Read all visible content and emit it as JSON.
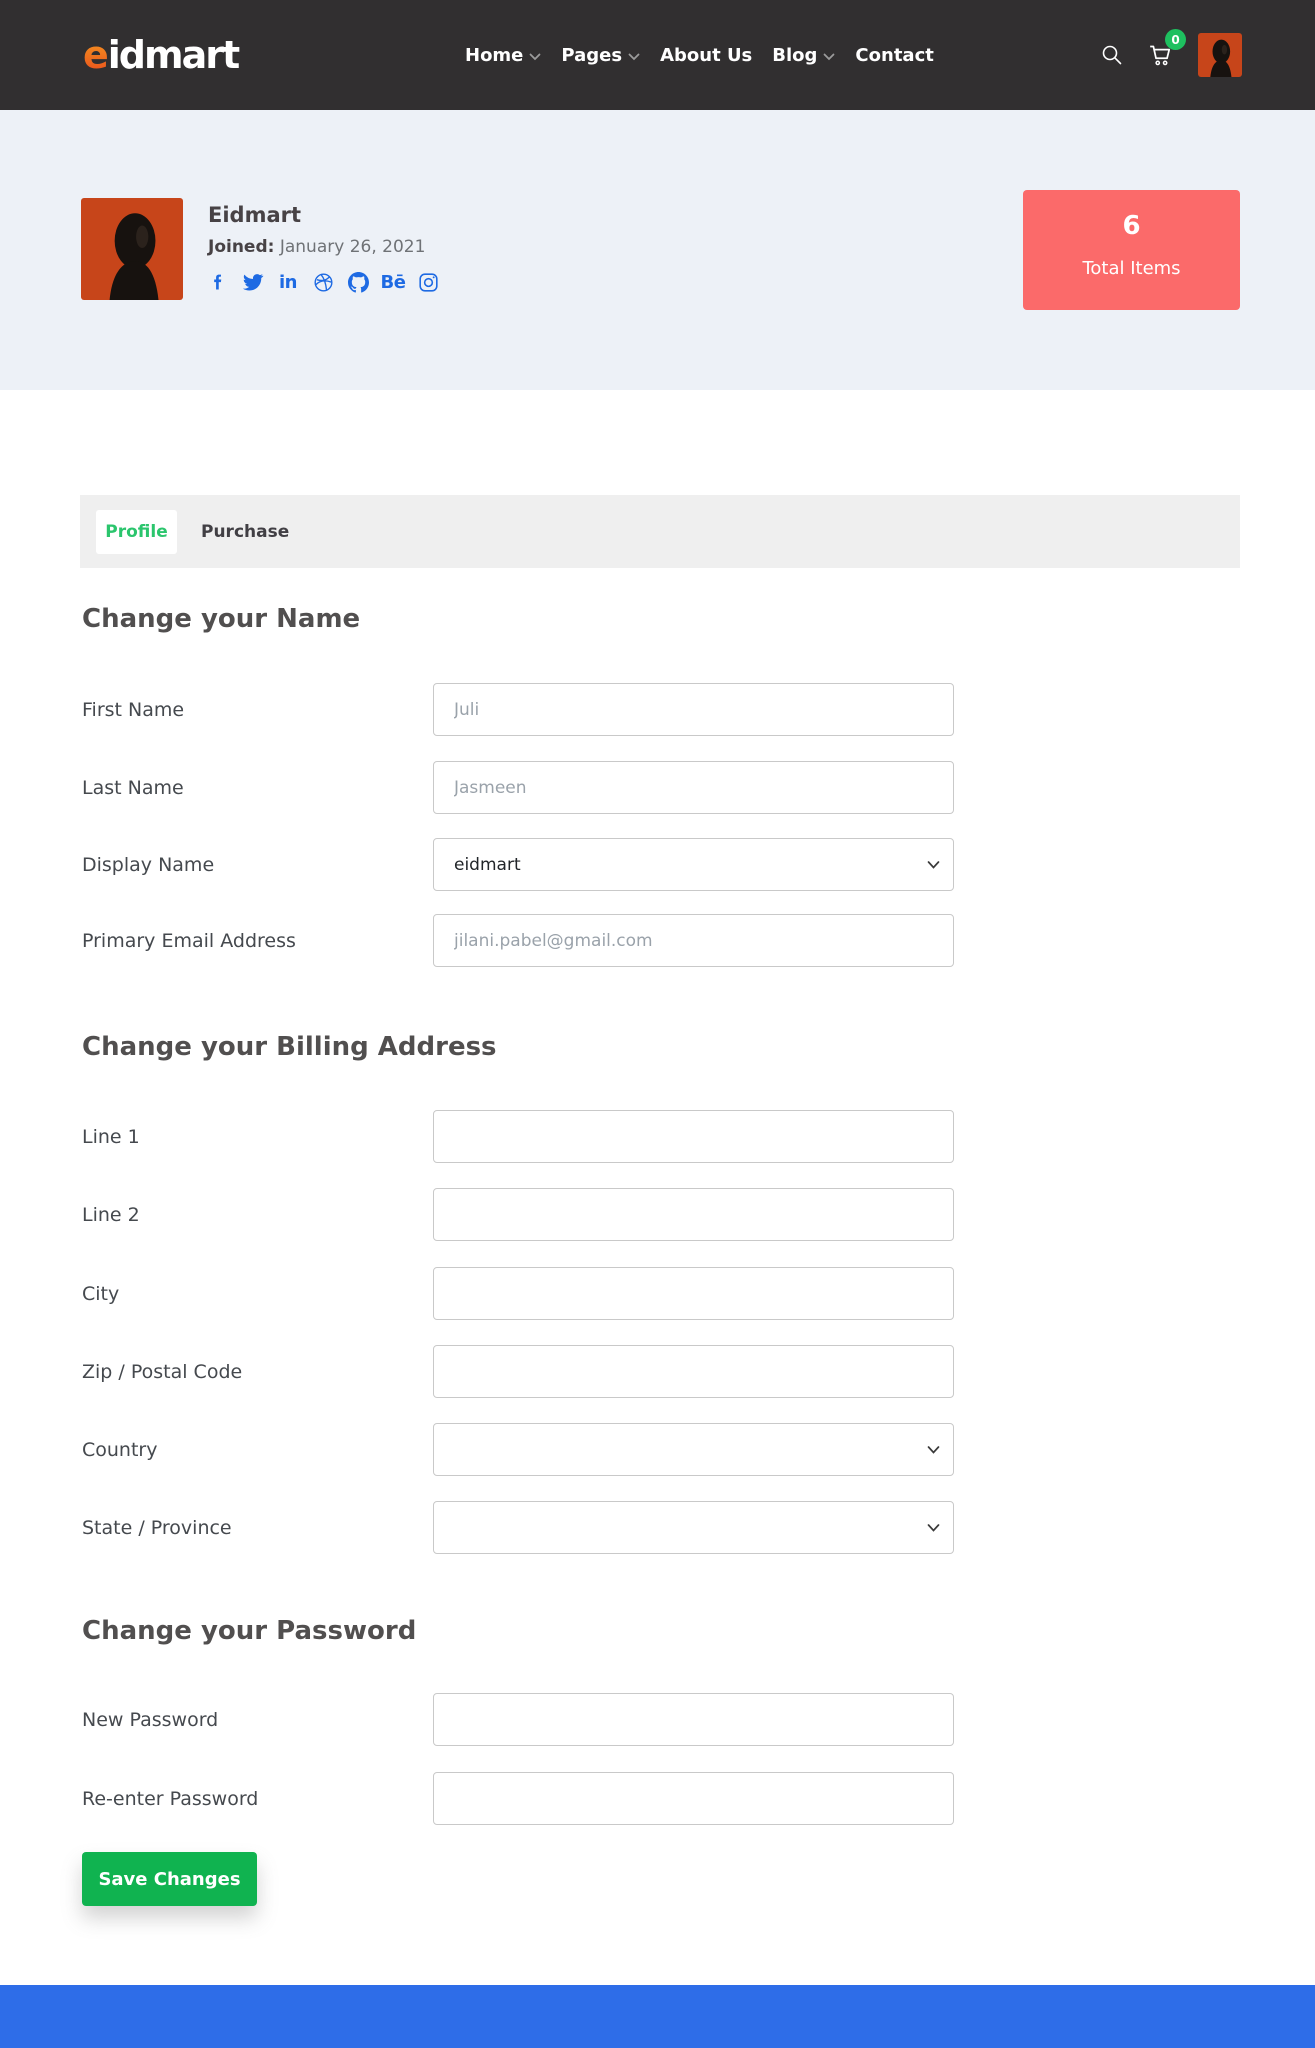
{
  "navbar": {
    "logo": {
      "accent": "e",
      "rest": "idmart"
    },
    "items": [
      {
        "label": "Home"
      },
      {
        "label": "Pages"
      },
      {
        "label": "About Us"
      },
      {
        "label": "Blog"
      },
      {
        "label": "Contact"
      }
    ],
    "cart_badge": "0"
  },
  "hero": {
    "name": "Eidmart",
    "joined_label": "Joined:",
    "joined_date": "January 26, 2021",
    "social_icons": [
      "facebook",
      "twitter",
      "linkedin",
      "dribbble",
      "github",
      "behance",
      "instagram"
    ],
    "behance_glyph": "Bē",
    "linkedin_glyph": "in",
    "stat_card": {
      "value": "6",
      "label": "Total Items"
    }
  },
  "tabs": {
    "profile": "Profile",
    "purchase": "Purchase"
  },
  "sections": {
    "name": {
      "heading": "Change your Name",
      "fields": [
        {
          "label": "First Name",
          "placeholder": "Juli"
        },
        {
          "label": "Last Name",
          "placeholder": "Jasmeen"
        },
        {
          "label": "Display Name",
          "value": "eidmart"
        },
        {
          "label": "Primary Email Address",
          "placeholder": "jilani.pabel@gmail.com"
        }
      ]
    },
    "billing": {
      "heading": "Change your Billing Address",
      "fields": [
        {
          "label": "Line 1"
        },
        {
          "label": "Line 2"
        },
        {
          "label": "City"
        },
        {
          "label": "Zip / Postal Code"
        },
        {
          "label": "Country",
          "value": ""
        },
        {
          "label": "State / Province",
          "value": ""
        }
      ]
    },
    "password": {
      "heading": "Change your Password",
      "fields": [
        {
          "label": "New Password"
        },
        {
          "label": "Re-enter Password"
        }
      ]
    }
  },
  "save_button_label": "Save Changes",
  "colors": {
    "navbar_bg": "#312f30",
    "hero_bg": "#edf1f7",
    "accent_green": "#10b350",
    "tab_green": "#2bc56d",
    "badge_green": "#1ec05f",
    "card_red": "#fb6a6a",
    "link_blue": "#1e6ae3",
    "footer_blue": "#2e6de8"
  }
}
